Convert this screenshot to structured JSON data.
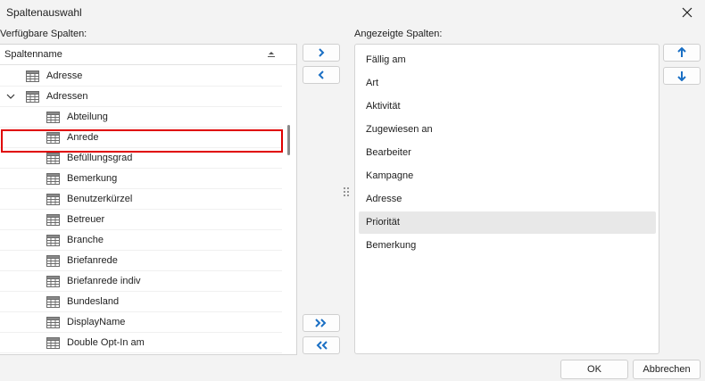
{
  "window": {
    "title": "Spaltenauswahl"
  },
  "available": {
    "caption": "Verfügbare Spalten:",
    "column_header": "Spaltenname",
    "rows": [
      {
        "label": "Adresse",
        "level": 0,
        "expander": ""
      },
      {
        "label": "Adressen",
        "level": 0,
        "expander": "chevron-down-icon"
      },
      {
        "label": "Abteilung",
        "level": 1
      },
      {
        "label": "Anrede",
        "level": 1
      },
      {
        "label": "Befüllungsgrad",
        "level": 1
      },
      {
        "label": "Bemerkung",
        "level": 1
      },
      {
        "label": "Benutzerkürzel",
        "level": 1
      },
      {
        "label": "Betreuer",
        "level": 1
      },
      {
        "label": "Branche",
        "level": 1
      },
      {
        "label": "Briefanrede",
        "level": 1
      },
      {
        "label": "Briefanrede indiv",
        "level": 1
      },
      {
        "label": "Bundesland",
        "level": 1
      },
      {
        "label": "DisplayName",
        "level": 1
      },
      {
        "label": "Double Opt-In am",
        "level": 1
      }
    ]
  },
  "displayed": {
    "caption": "Angezeigte Spalten:",
    "items": [
      {
        "label": "Fällig am",
        "selected": false
      },
      {
        "label": "Art",
        "selected": false
      },
      {
        "label": "Aktivität",
        "selected": false
      },
      {
        "label": "Zugewiesen an",
        "selected": false
      },
      {
        "label": "Bearbeiter",
        "selected": false
      },
      {
        "label": "Kampagne",
        "selected": false
      },
      {
        "label": "Adresse",
        "selected": false
      },
      {
        "label": "Priorität",
        "selected": true
      },
      {
        "label": "Bemerkung",
        "selected": false
      }
    ]
  },
  "buttons": {
    "ok": "OK",
    "cancel": "Abbrechen"
  },
  "icons": {
    "close": "close-icon",
    "add": "chevron-right-icon",
    "remove": "chevron-left-icon",
    "add_all": "double-chevron-right-icon",
    "remove_all": "double-chevron-left-icon",
    "move_up": "arrow-up-icon",
    "move_down": "arrow-down-icon",
    "sort": "sort-icon",
    "table": "table-icon",
    "grip": "grip-icon"
  },
  "colors": {
    "accent": "#1a6fc4",
    "highlight_border": "#e00000",
    "selected_bg": "#e8e8e8"
  }
}
